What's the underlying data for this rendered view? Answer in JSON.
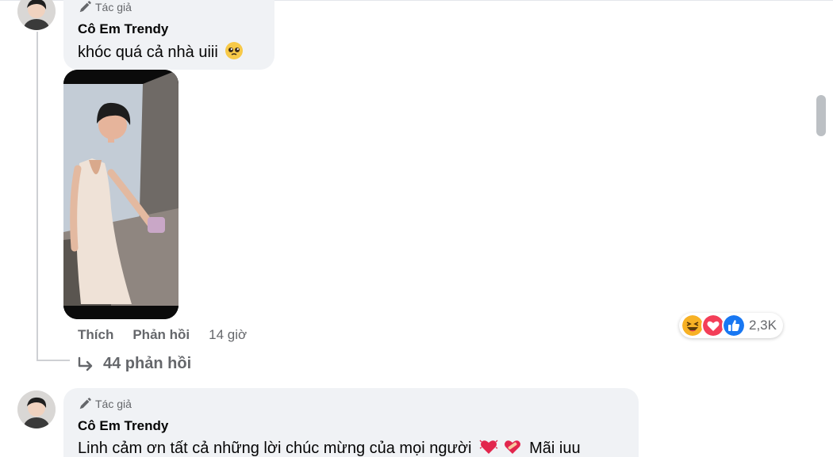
{
  "comment1": {
    "badge": "Tác giả",
    "author": "Cô Em Trendy",
    "text": "khóc quá cả nhà uiii",
    "emoji_icon": "pleading-face-icon"
  },
  "actions": {
    "like": "Thích",
    "reply": "Phản hồi",
    "time": "14 giờ"
  },
  "reactions": {
    "icons": [
      "haha-icon",
      "love-icon",
      "like-icon"
    ],
    "count": "2,3K"
  },
  "replies": {
    "label": "44 phản hồi"
  },
  "comment2": {
    "badge": "Tác giả",
    "author": "Cô Em Trendy",
    "text_part1": "Linh cảm ơn tất cả những lời chúc mừng của mọi người",
    "emoji_icons": [
      "beating-heart-icon",
      "mending-heart-icon"
    ],
    "text_part2": "Mãi iuu"
  },
  "colors": {
    "bubble": "#f0f2f5",
    "secondary_text": "#65676b",
    "like_blue": "#1877f2",
    "love_red": "#f33e58",
    "haha_yellow": "#f7b125"
  }
}
